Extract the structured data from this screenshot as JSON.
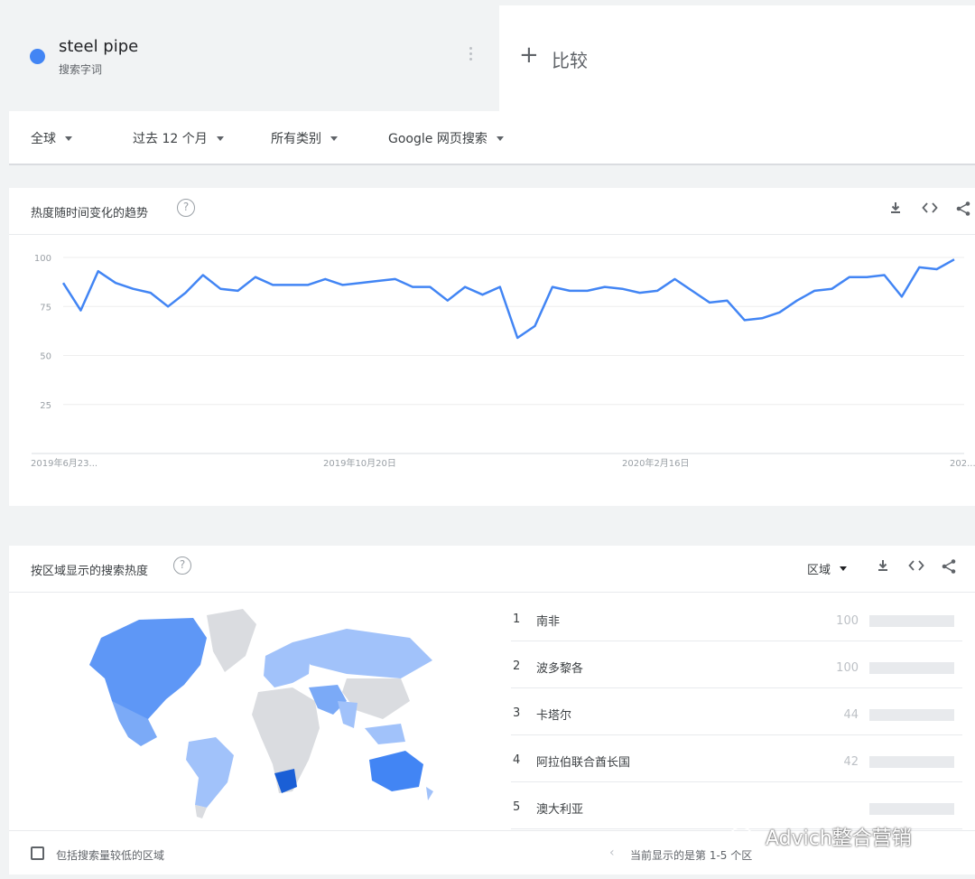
{
  "term": {
    "name": "steel pipe",
    "type": "搜索字词",
    "color": "#4285f4"
  },
  "compare": {
    "plus": "+",
    "label": "比较"
  },
  "filters": [
    {
      "label": "全球"
    },
    {
      "label": "过去 12 个月"
    },
    {
      "label": "所有类别"
    },
    {
      "label": "Google 网页搜索"
    }
  ],
  "trend_card": {
    "title": "热度随时间变化的趋势",
    "help": "?"
  },
  "region_card": {
    "title": "按区域显示的搜索热度",
    "help": "?",
    "resolution": "区域"
  },
  "icons": {
    "download": "download-icon",
    "embed": "embed-icon",
    "share": "share-icon"
  },
  "chart_data": {
    "type": "line",
    "x_labels": [
      "2019年6月23...",
      "2019年10月20日",
      "2020年2月16日",
      "202..."
    ],
    "y_ticks": [
      25,
      50,
      75,
      100
    ],
    "ylim": [
      0,
      100
    ],
    "series": [
      {
        "color": "#4285f4",
        "values": [
          87,
          73,
          93,
          87,
          84,
          82,
          75,
          82,
          91,
          84,
          83,
          90,
          86,
          86,
          86,
          89,
          86,
          87,
          88,
          89,
          85,
          85,
          78,
          85,
          81,
          85,
          59,
          65,
          85,
          83,
          83,
          85,
          84,
          82,
          83,
          89,
          83,
          77,
          78,
          68,
          69,
          72,
          78,
          83,
          84,
          90,
          90,
          91,
          80,
          95,
          94,
          99
        ]
      }
    ]
  },
  "regions": [
    {
      "rank": "1",
      "name": "南非",
      "value": 100
    },
    {
      "rank": "2",
      "name": "波多黎各",
      "value": 100
    },
    {
      "rank": "3",
      "name": "卡塔尔",
      "value": 44
    },
    {
      "rank": "4",
      "name": "阿拉伯联合酋长国",
      "value": 42
    },
    {
      "rank": "5",
      "name": "澳大利亚",
      "value": ""
    }
  ],
  "footer": {
    "checkbox_label": "包括搜索量较低的区域",
    "pager_prev": "‹",
    "pager_text": "当前显示的是第 1-5 个区"
  },
  "watermark": {
    "text": "Advich整合营销"
  }
}
